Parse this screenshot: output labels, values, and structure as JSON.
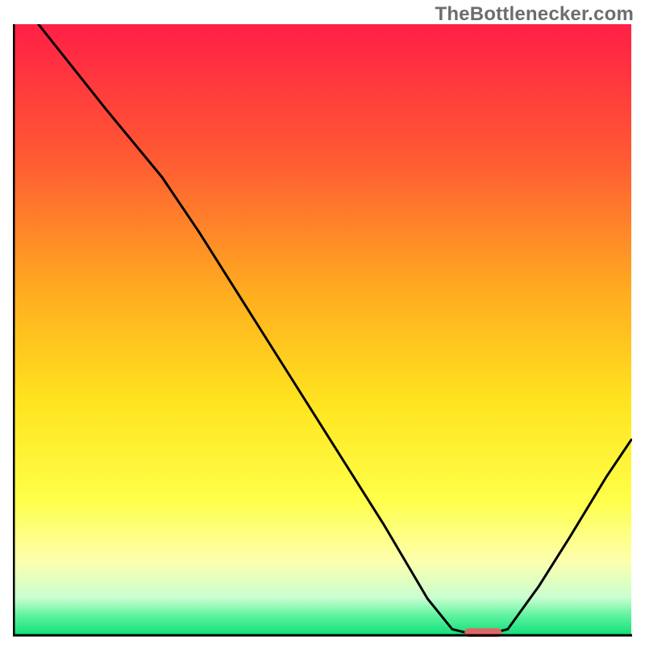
{
  "watermark": "TheBottlenecker.com",
  "colors": {
    "gradient_top": "#ff1f46",
    "gradient_mid_upper": "#ff7a2a",
    "gradient_mid": "#ffd21f",
    "gradient_mid_lower": "#ffff66",
    "gradient_lower": "#fbffb8",
    "gradient_green_light": "#8effb4",
    "gradient_green": "#12e07a",
    "curve_stroke": "#000000",
    "marker_fill": "#e06666",
    "axis_stroke": "#000000"
  },
  "chart_data": {
    "type": "line",
    "title": "",
    "xlabel": "",
    "ylabel": "",
    "xlim": [
      0,
      100
    ],
    "ylim": [
      0,
      100
    ],
    "curve": [
      {
        "x": 4,
        "y": 100
      },
      {
        "x": 15,
        "y": 86
      },
      {
        "x": 24,
        "y": 75
      },
      {
        "x": 30,
        "y": 66
      },
      {
        "x": 40,
        "y": 50
      },
      {
        "x": 50,
        "y": 34
      },
      {
        "x": 60,
        "y": 18
      },
      {
        "x": 67,
        "y": 6
      },
      {
        "x": 71,
        "y": 1
      },
      {
        "x": 73,
        "y": 0.5
      },
      {
        "x": 78,
        "y": 0.5
      },
      {
        "x": 80,
        "y": 1
      },
      {
        "x": 85,
        "y": 8
      },
      {
        "x": 90,
        "y": 16
      },
      {
        "x": 96,
        "y": 26
      },
      {
        "x": 100,
        "y": 32
      }
    ],
    "minimum_marker": {
      "x_start": 73,
      "x_end": 79,
      "y": 0.5
    }
  }
}
